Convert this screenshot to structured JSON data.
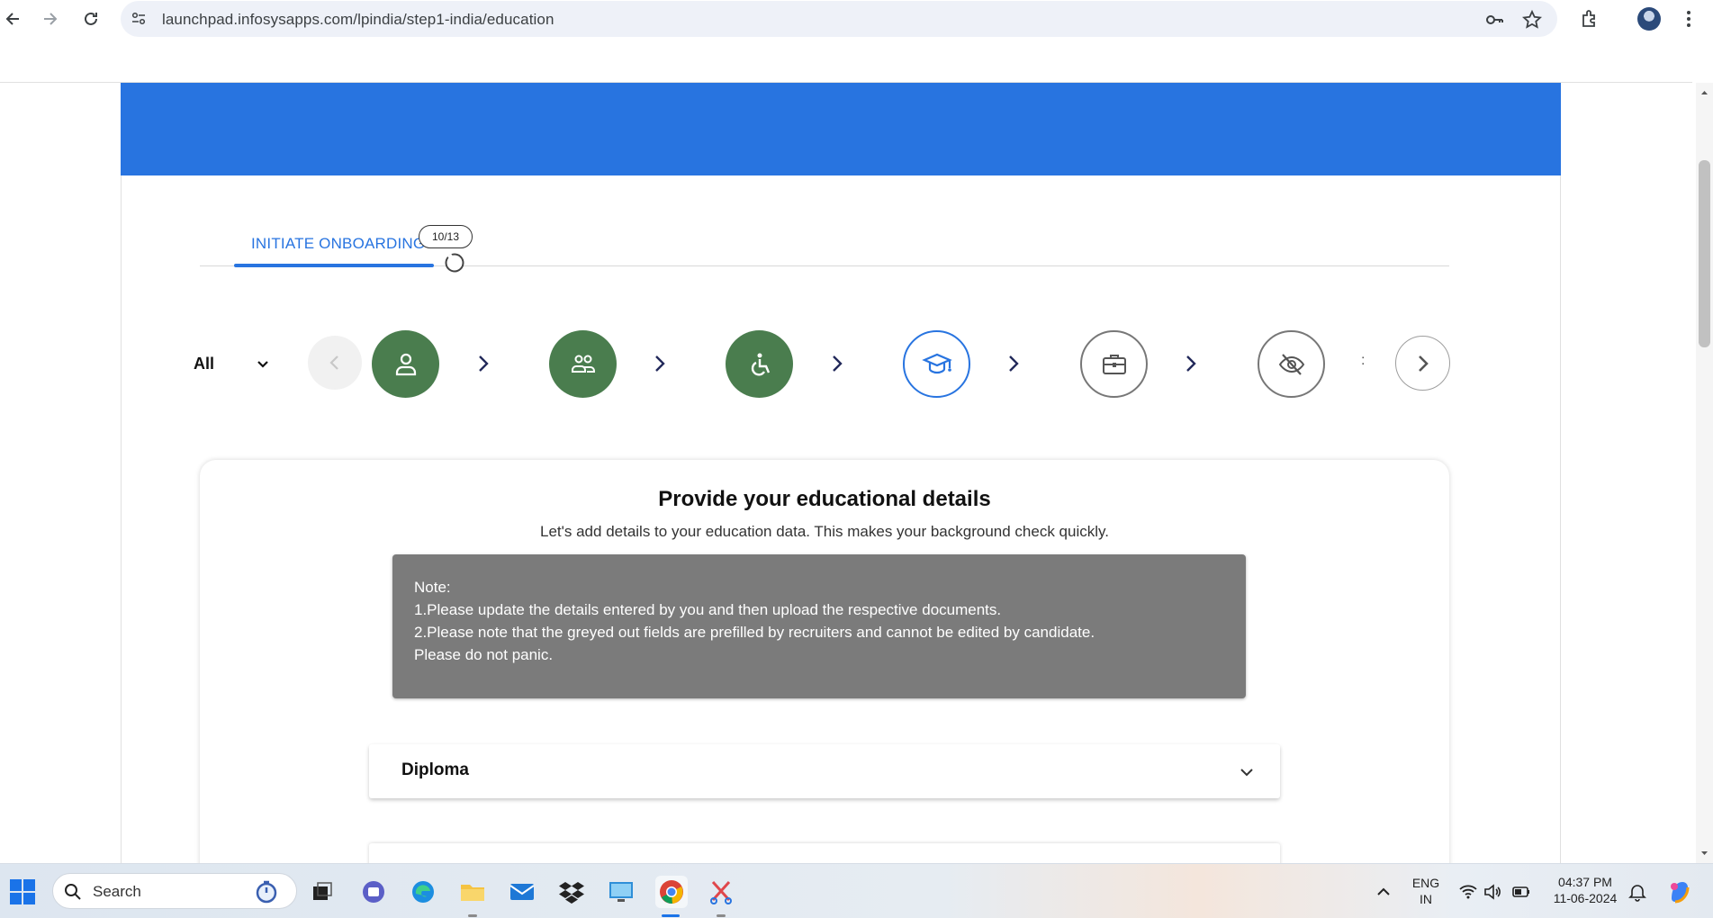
{
  "browser": {
    "url": "launchpad.infosysapps.com/lpindia/step1-india/education",
    "back_icon": "arrow-left-icon",
    "forward_icon": "arrow-right-icon",
    "reload_icon": "reload-icon"
  },
  "tabs": {
    "active_label": "INITIATE ONBOARDING",
    "progress_badge": "10/13"
  },
  "stepper": {
    "filter_label": "All",
    "overflow_marker": ":",
    "steps": [
      {
        "icon": "person-icon",
        "state": "done"
      },
      {
        "icon": "family-icon",
        "state": "done"
      },
      {
        "icon": "accessibility-icon",
        "state": "done"
      },
      {
        "icon": "graduation-cap-icon",
        "state": "active"
      },
      {
        "icon": "briefcase-icon",
        "state": "todo"
      },
      {
        "icon": "visibility-off-icon",
        "state": "todo"
      }
    ]
  },
  "card": {
    "title": "Provide your educational details",
    "subtitle": "Let's add details to your education data. This makes your background check quickly.",
    "note_lines": [
      "Note:",
      "1.Please update the details entered by you and then upload the respective documents.",
      "2.Please note that the greyed out fields are prefilled by recruiters and cannot be edited by candidate.",
      "Please do not panic."
    ],
    "accordion_title": "Diploma"
  },
  "taskbar": {
    "search_placeholder": "Search",
    "language_line1": "ENG",
    "language_line2": "IN",
    "time": "04:37 PM",
    "date": "11-06-2024"
  },
  "colors": {
    "brand_blue": "#2874e0",
    "step_done_green": "#4a7d4e",
    "note_grey": "#7b7b7b"
  }
}
